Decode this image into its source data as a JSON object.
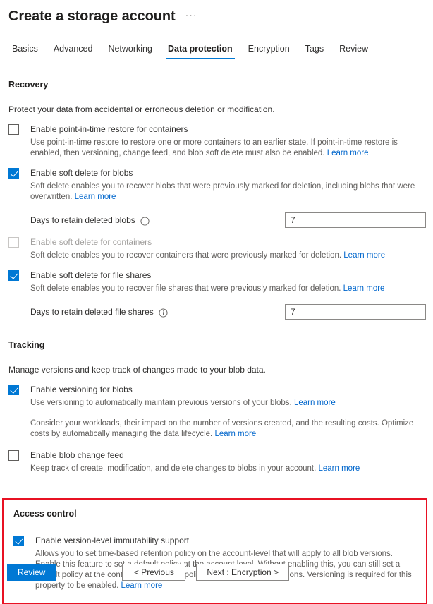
{
  "header": {
    "title": "Create a storage account",
    "ellipsis": "···"
  },
  "tabs": [
    {
      "label": "Basics",
      "active": false
    },
    {
      "label": "Advanced",
      "active": false
    },
    {
      "label": "Networking",
      "active": false
    },
    {
      "label": "Data protection",
      "active": true
    },
    {
      "label": "Encryption",
      "active": false
    },
    {
      "label": "Tags",
      "active": false
    },
    {
      "label": "Review",
      "active": false
    }
  ],
  "recovery": {
    "title": "Recovery",
    "intro": "Protect your data from accidental or erroneous deletion or modification.",
    "pitr": {
      "label": "Enable point-in-time restore for containers",
      "checked": false,
      "desc": "Use point-in-time restore to restore one or more containers to an earlier state. If point-in-time restore is enabled, then versioning, change feed, and blob soft delete must also be enabled. ",
      "learn_more": "Learn more"
    },
    "soft_delete_blobs": {
      "label": "Enable soft delete for blobs",
      "checked": true,
      "desc": "Soft delete enables you to recover blobs that were previously marked for deletion, including blobs that were overwritten. ",
      "learn_more": "Learn more"
    },
    "blob_retention": {
      "label": "Days to retain deleted blobs",
      "info_icon": "info-icon",
      "value": "7"
    },
    "soft_delete_containers": {
      "label": "Enable soft delete for containers",
      "checked": false,
      "disabled": true,
      "desc": "Soft delete enables you to recover containers that were previously marked for deletion. ",
      "learn_more": "Learn more"
    },
    "soft_delete_file_shares": {
      "label": "Enable soft delete for file shares",
      "checked": true,
      "desc": "Soft delete enables you to recover file shares that were previously marked for deletion. ",
      "learn_more": "Learn more"
    },
    "file_share_retention": {
      "label": "Days to retain deleted file shares",
      "info_icon": "info-icon",
      "value": "7"
    }
  },
  "tracking": {
    "title": "Tracking",
    "intro": "Manage versions and keep track of changes made to your blob data.",
    "versioning": {
      "label": "Enable versioning for blobs",
      "checked": true,
      "desc": "Use versioning to automatically maintain previous versions of your blobs. ",
      "learn_more": "Learn more",
      "desc2": "Consider your workloads, their impact on the number of versions created, and the resulting costs. Optimize costs by automatically managing the data lifecycle. ",
      "learn_more2": "Learn more"
    },
    "change_feed": {
      "label": "Enable blob change feed",
      "checked": false,
      "desc": "Keep track of create, modification, and delete changes to blobs in your account. ",
      "learn_more": "Learn more"
    }
  },
  "access_control": {
    "title": "Access control",
    "highlight_color": "#e81123",
    "immutability": {
      "label": "Enable version-level immutability support",
      "checked": true,
      "desc": "Allows you to set time-based retention policy on the account-level that will apply to all blob versions. Enable this feature to set a default policy at the account level. Without enabling this, you can still set a default policy at the container level or set policies for specific blob versions. Versioning is required for this property to be enabled. ",
      "learn_more": "Learn more"
    }
  },
  "footer": {
    "review": "Review",
    "previous": "< Previous",
    "next": "Next : Encryption >"
  },
  "colors": {
    "accent": "#0078d4",
    "link": "#0066cc",
    "highlight": "#e81123"
  }
}
